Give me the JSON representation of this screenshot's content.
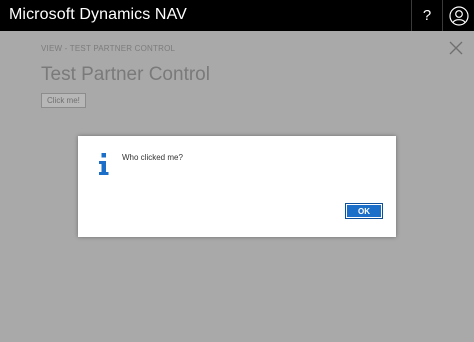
{
  "header": {
    "app_title": "Microsoft Dynamics NAV",
    "help_label": "?",
    "help_icon": "help-icon",
    "avatar_icon": "user-avatar-icon"
  },
  "page": {
    "breadcrumb": "VIEW - TEST PARTNER CONTROL",
    "title": "Test Partner Control",
    "button_label": "Click me!",
    "close_icon": "close-icon"
  },
  "dialog": {
    "icon": "info-icon",
    "message": "Who clicked me?",
    "ok_label": "OK",
    "accent_color": "#1c6fc9"
  }
}
